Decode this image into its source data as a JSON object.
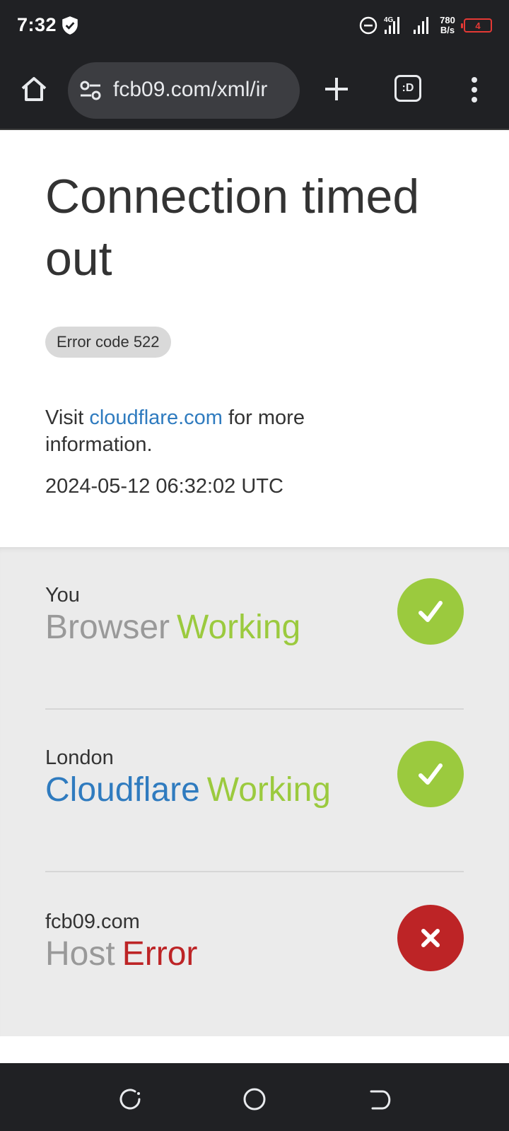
{
  "status_bar": {
    "time": "7:32",
    "network_type": "4G",
    "speed_value": "780",
    "speed_unit": "B/s",
    "battery_level": "4"
  },
  "toolbar": {
    "url": "fcb09.com/xml/ir",
    "tab_count": ":D"
  },
  "page": {
    "title": "Connection timed out",
    "error_code_label": "Error code 522",
    "info_prefix": "Visit",
    "info_link": "cloudflare.com",
    "info_suffix": "for more information.",
    "timestamp": "2024-05-12 06:32:02 UTC"
  },
  "status_rows": [
    {
      "location": "You",
      "name": "Browser",
      "status": "Working",
      "state": "ok"
    },
    {
      "location": "London",
      "name": "Cloudflare",
      "status": "Working",
      "state": "ok"
    },
    {
      "location": "fcb09.com",
      "name": "Host",
      "status": "Error",
      "state": "error"
    }
  ],
  "colors": {
    "ok": "#9bca3e",
    "error": "#bd2426",
    "link": "#2f7bbf",
    "toolbar_bg": "#202124"
  },
  "icons": {
    "status_bar": [
      "shield-icon",
      "do-not-disturb-icon",
      "signal-4g-icon",
      "signal-icon",
      "battery-icon"
    ],
    "toolbar": [
      "home-icon",
      "site-settings-icon",
      "new-tab-icon",
      "tab-switcher-icon",
      "more-menu-icon"
    ],
    "status": [
      "check-icon",
      "cross-icon"
    ],
    "navigation": [
      "recent-apps-icon",
      "home-circle-icon",
      "back-icon"
    ]
  }
}
